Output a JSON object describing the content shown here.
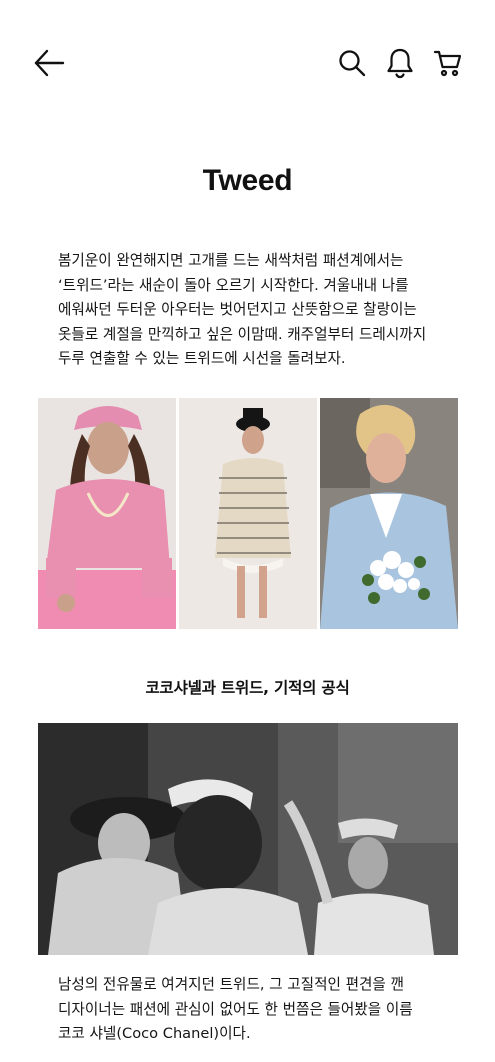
{
  "header": {
    "back_icon": "arrow-left-icon",
    "search_icon": "search-icon",
    "notification_icon": "bell-icon",
    "cart_icon": "cart-icon"
  },
  "article": {
    "title": "Tweed",
    "intro": "봄기운이 완연해지면 고개를 드는 새싹처럼 패션계에서는 ‘트위드’라는 새순이 돌아 오르기 시작한다. 겨울내내 나를 에워싸던 두터운 아우터는 벗어던지고 산뜻함으로 찰랑이는 옷들로 계절을 만끽하고 싶은 이맘때. 캐주얼부터 드레시까지 두루 연출할 수 있는 트위드에 시선을 돌려보자.",
    "section_heading": "코코샤넬과 트위드, 기적의 공식",
    "section_body": "남성의 전유물로 여겨지던 트위드, 그 고질적인 편견을 깬 디자이너는 패션에 관심이 없어도 한 번쯤은 들어봤을 이름 코코 샤넬(Coco Chanel)이다."
  },
  "colors": {
    "text": "#111111",
    "pink_tweed": "#e98fb0",
    "light_blue_tweed": "#a9c4de",
    "cream_tweed": "#e8dfcf"
  }
}
